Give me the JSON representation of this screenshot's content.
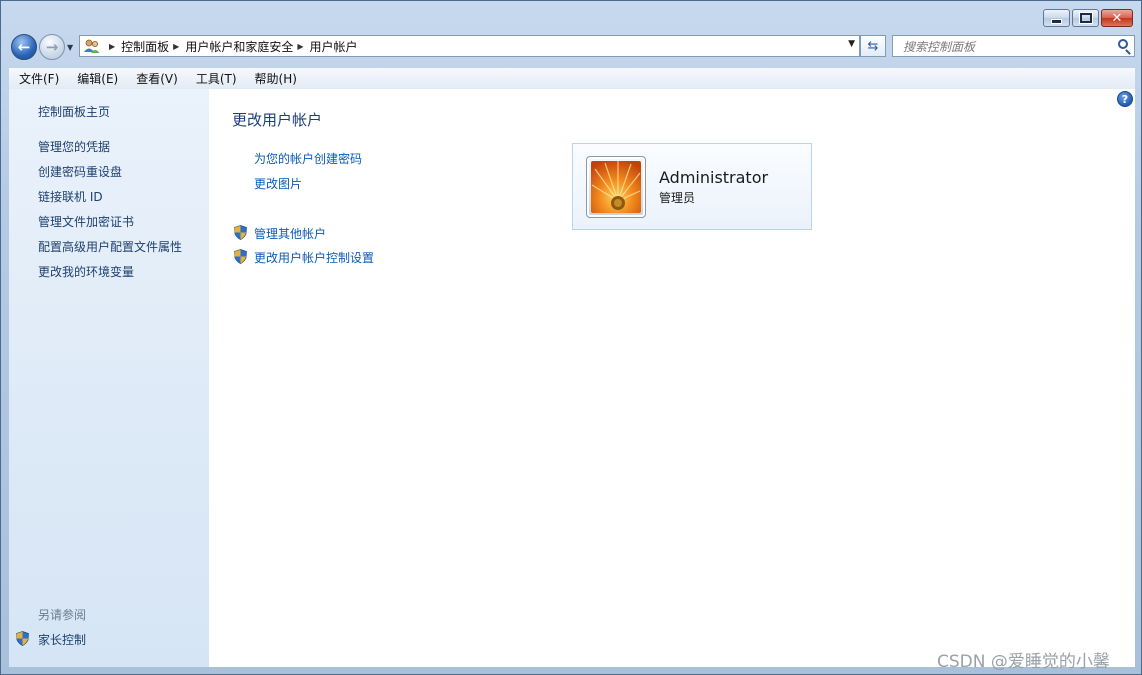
{
  "window": {
    "controls": {
      "minimize": "minimize",
      "maximize": "maximize",
      "close": "close"
    }
  },
  "nav": {
    "breadcrumbs": [
      "控制面板",
      "用户帐户和家庭安全",
      "用户帐户"
    ],
    "search_placeholder": "搜索控制面板"
  },
  "menu": {
    "items": [
      "文件(F)",
      "编辑(E)",
      "查看(V)",
      "工具(T)",
      "帮助(H)"
    ]
  },
  "sidebar": {
    "home": "控制面板主页",
    "links": [
      "管理您的凭据",
      "创建密码重设盘",
      "链接联机 ID",
      "管理文件加密证书",
      "配置高级用户配置文件属性",
      "更改我的环境变量"
    ],
    "see_also_title": "另请参阅",
    "see_also_links": [
      "家长控制"
    ]
  },
  "main": {
    "title": "更改用户帐户",
    "tasks": [
      "为您的帐户创建密码",
      "更改图片"
    ],
    "admin_tasks": [
      "管理其他帐户",
      "更改用户帐户控制设置"
    ]
  },
  "account": {
    "name": "Administrator",
    "role": "管理员"
  },
  "help_icon_label": "?",
  "watermark": "CSDN @爱睡觉的小馨",
  "icons": {
    "back": "back-arrow-icon",
    "forward": "forward-arrow-icon",
    "refresh": "refresh-icon",
    "search": "search-icon",
    "shield": "uac-shield-icon",
    "help": "help-icon",
    "address": "users-icon"
  }
}
